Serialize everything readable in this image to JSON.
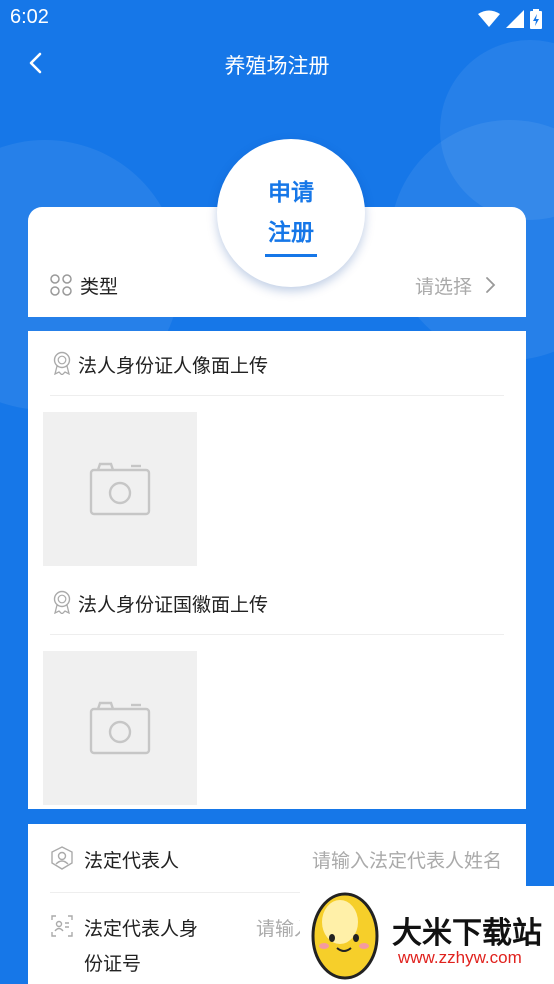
{
  "status_bar": {
    "time": "6:02"
  },
  "header": {
    "title": "养殖场注册"
  },
  "badge": {
    "line1": "申请",
    "line2": "注册"
  },
  "type_row": {
    "label": "类型",
    "placeholder": "请选择"
  },
  "uploads": [
    {
      "label": "法人身份证人像面上传"
    },
    {
      "label": "法人身份证国徽面上传"
    }
  ],
  "form": {
    "legal_rep": {
      "label": "法定代表人",
      "placeholder": "请输入法定代表人姓名"
    },
    "legal_rep_id": {
      "label_line1": "法定代表人身",
      "label_line2": "份证号",
      "placeholder": "请输入"
    }
  },
  "watermark": {
    "name": "大米下载站",
    "url": "www.zzhyw.com"
  },
  "colors": {
    "primary": "#1677e8",
    "placeholder": "#aaaaaa",
    "watermark_red": "#e0221e"
  }
}
